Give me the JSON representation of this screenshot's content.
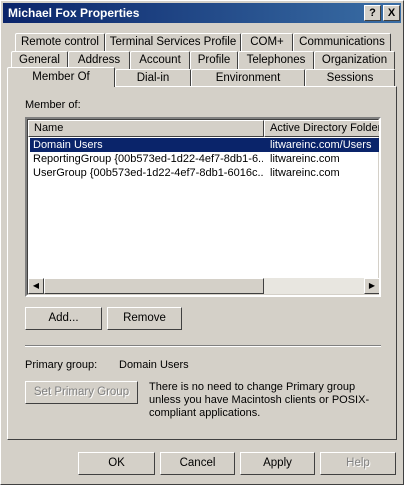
{
  "window": {
    "title": "Michael Fox Properties",
    "help_btn": "?",
    "close_btn": "X"
  },
  "tabs": {
    "row1": [
      "Remote control",
      "Terminal Services Profile",
      "COM+",
      "Communications"
    ],
    "row2": [
      "General",
      "Address",
      "Account",
      "Profile",
      "Telephones",
      "Organization"
    ],
    "row3": [
      "Member Of",
      "Dial-in",
      "Environment",
      "Sessions"
    ],
    "selected": "Member Of"
  },
  "member_of": {
    "label": "Member of:",
    "columns": [
      "Name",
      "Active Directory Folder"
    ],
    "rows": [
      {
        "name": "Domain Users",
        "folder": "litwareinc.com/Users",
        "selected": true
      },
      {
        "name": "ReportingGroup {00b573ed-1d22-4ef7-8db1-6...",
        "folder": "litwareinc.com",
        "selected": false
      },
      {
        "name": "UserGroup {00b573ed-1d22-4ef7-8db1-6016c...",
        "folder": "litwareinc.com",
        "selected": false
      }
    ]
  },
  "buttons": {
    "add": "Add...",
    "remove": "Remove",
    "set_primary": "Set Primary Group",
    "ok": "OK",
    "cancel": "Cancel",
    "apply": "Apply",
    "help": "Help"
  },
  "primary_group": {
    "label": "Primary group:",
    "value": "Domain Users",
    "note": "There is no need to change Primary group unless you have Macintosh clients or POSIX-compliant applications."
  },
  "colors": {
    "title_bar": "#0a246a",
    "selection": "#0a246a",
    "face": "#d4d0c8"
  }
}
